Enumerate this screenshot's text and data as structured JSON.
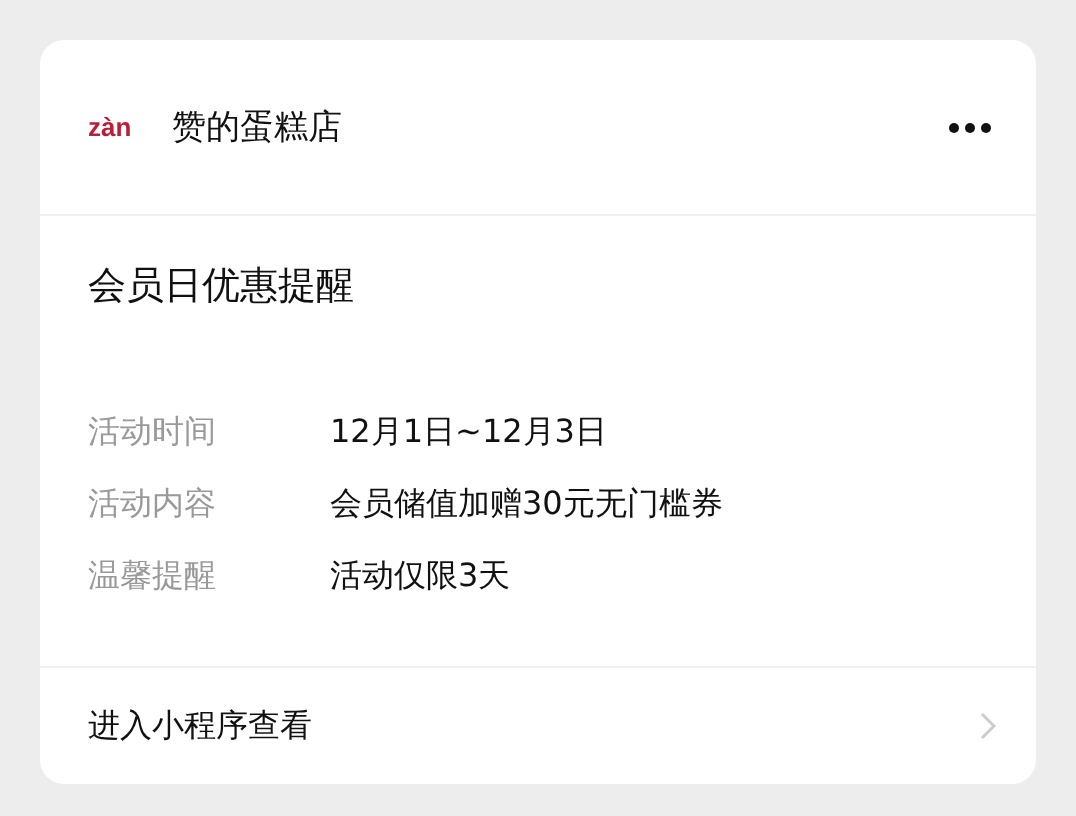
{
  "header": {
    "logo": "zàn",
    "name": "赞的蛋糕店"
  },
  "title": "会员日优惠提醒",
  "details": [
    {
      "label": "活动时间",
      "value": "12月1日~12月3日"
    },
    {
      "label": "活动内容",
      "value": "会员储值加赠30元无门槛券"
    },
    {
      "label": "温馨提醒",
      "value": "活动仅限3天"
    }
  ],
  "footer": {
    "link": "进入小程序查看"
  }
}
